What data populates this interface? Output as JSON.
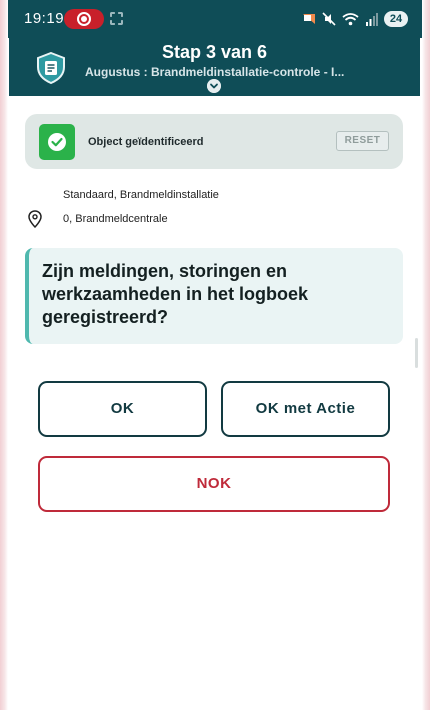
{
  "status_bar": {
    "time": "19:19",
    "battery_level": "24",
    "icons": [
      "screen-record-icon",
      "cast-icon",
      "notification-icon",
      "mute-icon",
      "wifi-icon",
      "signal-icon",
      "battery-icon"
    ]
  },
  "header": {
    "title": "Stap 3 van 6",
    "subtitle": "Augustus : Brandmeldinstallatie-controle - I...",
    "logo_icon": "shield-document-icon",
    "expand_icon": "chevron-down-icon"
  },
  "object": {
    "status_label": "Object geïdentificeerd",
    "reset_label": "RESET",
    "check_icon": "checkmark-icon"
  },
  "meta": {
    "line1": "Standaard, Brandmeldinstallatie",
    "line2": "0, Brandmeldcentrale",
    "location_icon": "location-pin-icon"
  },
  "question": {
    "text": "Zijn meldingen, storingen en werkzaamheden in het logboek geregistreerd?"
  },
  "answers": {
    "ok": "OK",
    "ok_actie": "OK met Actie",
    "nok": "NOK"
  },
  "colors": {
    "header_bg": "#0f4d57",
    "success_green": "#2bb24a",
    "accent_teal": "#4fb8ae",
    "nok_red": "#bf2a3a",
    "primary_dark": "#123a41"
  }
}
